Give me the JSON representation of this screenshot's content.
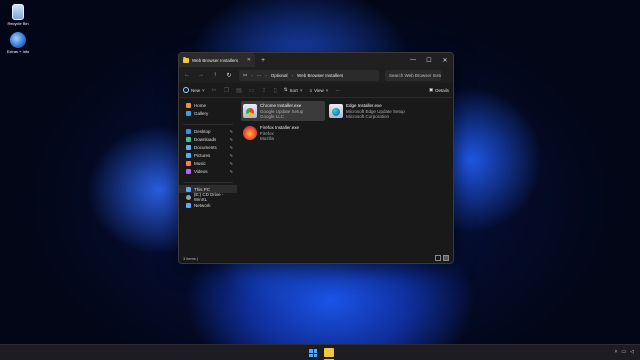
{
  "desktop": {
    "icons": [
      {
        "label": "Recycle Bin"
      },
      {
        "label": "Extras + Info"
      }
    ]
  },
  "window": {
    "tab_title": "Web Browser Installers",
    "controls": {
      "minimize": "—",
      "maximize": "☐",
      "close": "✕"
    },
    "new_tab": "+",
    "breadcrumb": [
      "Optional",
      "Web Browser Installers"
    ],
    "breadcrumb_more": "···",
    "search_placeholder": "Search Web Browser Installers",
    "toolbar": {
      "new_label": "New",
      "sort_label": "Sort",
      "view_label": "View",
      "more_label": "···",
      "details_label": "Details"
    },
    "sidebar": {
      "top": [
        {
          "label": "Home",
          "color": "#e8943a"
        },
        {
          "label": "Gallery",
          "color": "#3aa0e8"
        }
      ],
      "quick": [
        {
          "label": "Desktop",
          "color": "#3a8ee8"
        },
        {
          "label": "Downloads",
          "color": "#3ac38e"
        },
        {
          "label": "Documents",
          "color": "#6fa8ff"
        },
        {
          "label": "Pictures",
          "color": "#4ab0ff"
        },
        {
          "label": "Music",
          "color": "#ff7a59"
        },
        {
          "label": "Videos",
          "color": "#a46cff"
        }
      ],
      "devices": [
        {
          "label": "This PC",
          "color": "#5aa8ff"
        },
        {
          "label": "(E:) CD Drive - WinXL",
          "color": "#9aa0a6"
        },
        {
          "label": "Network",
          "color": "#5aa8ff"
        }
      ]
    },
    "files": [
      {
        "name": "Chrome Installer.exe",
        "line2": "Google Update Setup",
        "line3": "Google LLC",
        "icon": "chrome-installer-icon"
      },
      {
        "name": "Edge Installer.exe",
        "line2": "Microsoft Edge Update Setup",
        "line3": "Microsoft Corporation",
        "icon": "edge-installer-icon"
      },
      {
        "name": "Firefox Installer.exe",
        "line2": "Firefox",
        "line3": "Mozilla",
        "icon": "firefox-installer-icon"
      }
    ],
    "status": "3 items  |"
  },
  "colors": {
    "window_bg": "#191919",
    "accent": "#4fa9ff"
  }
}
